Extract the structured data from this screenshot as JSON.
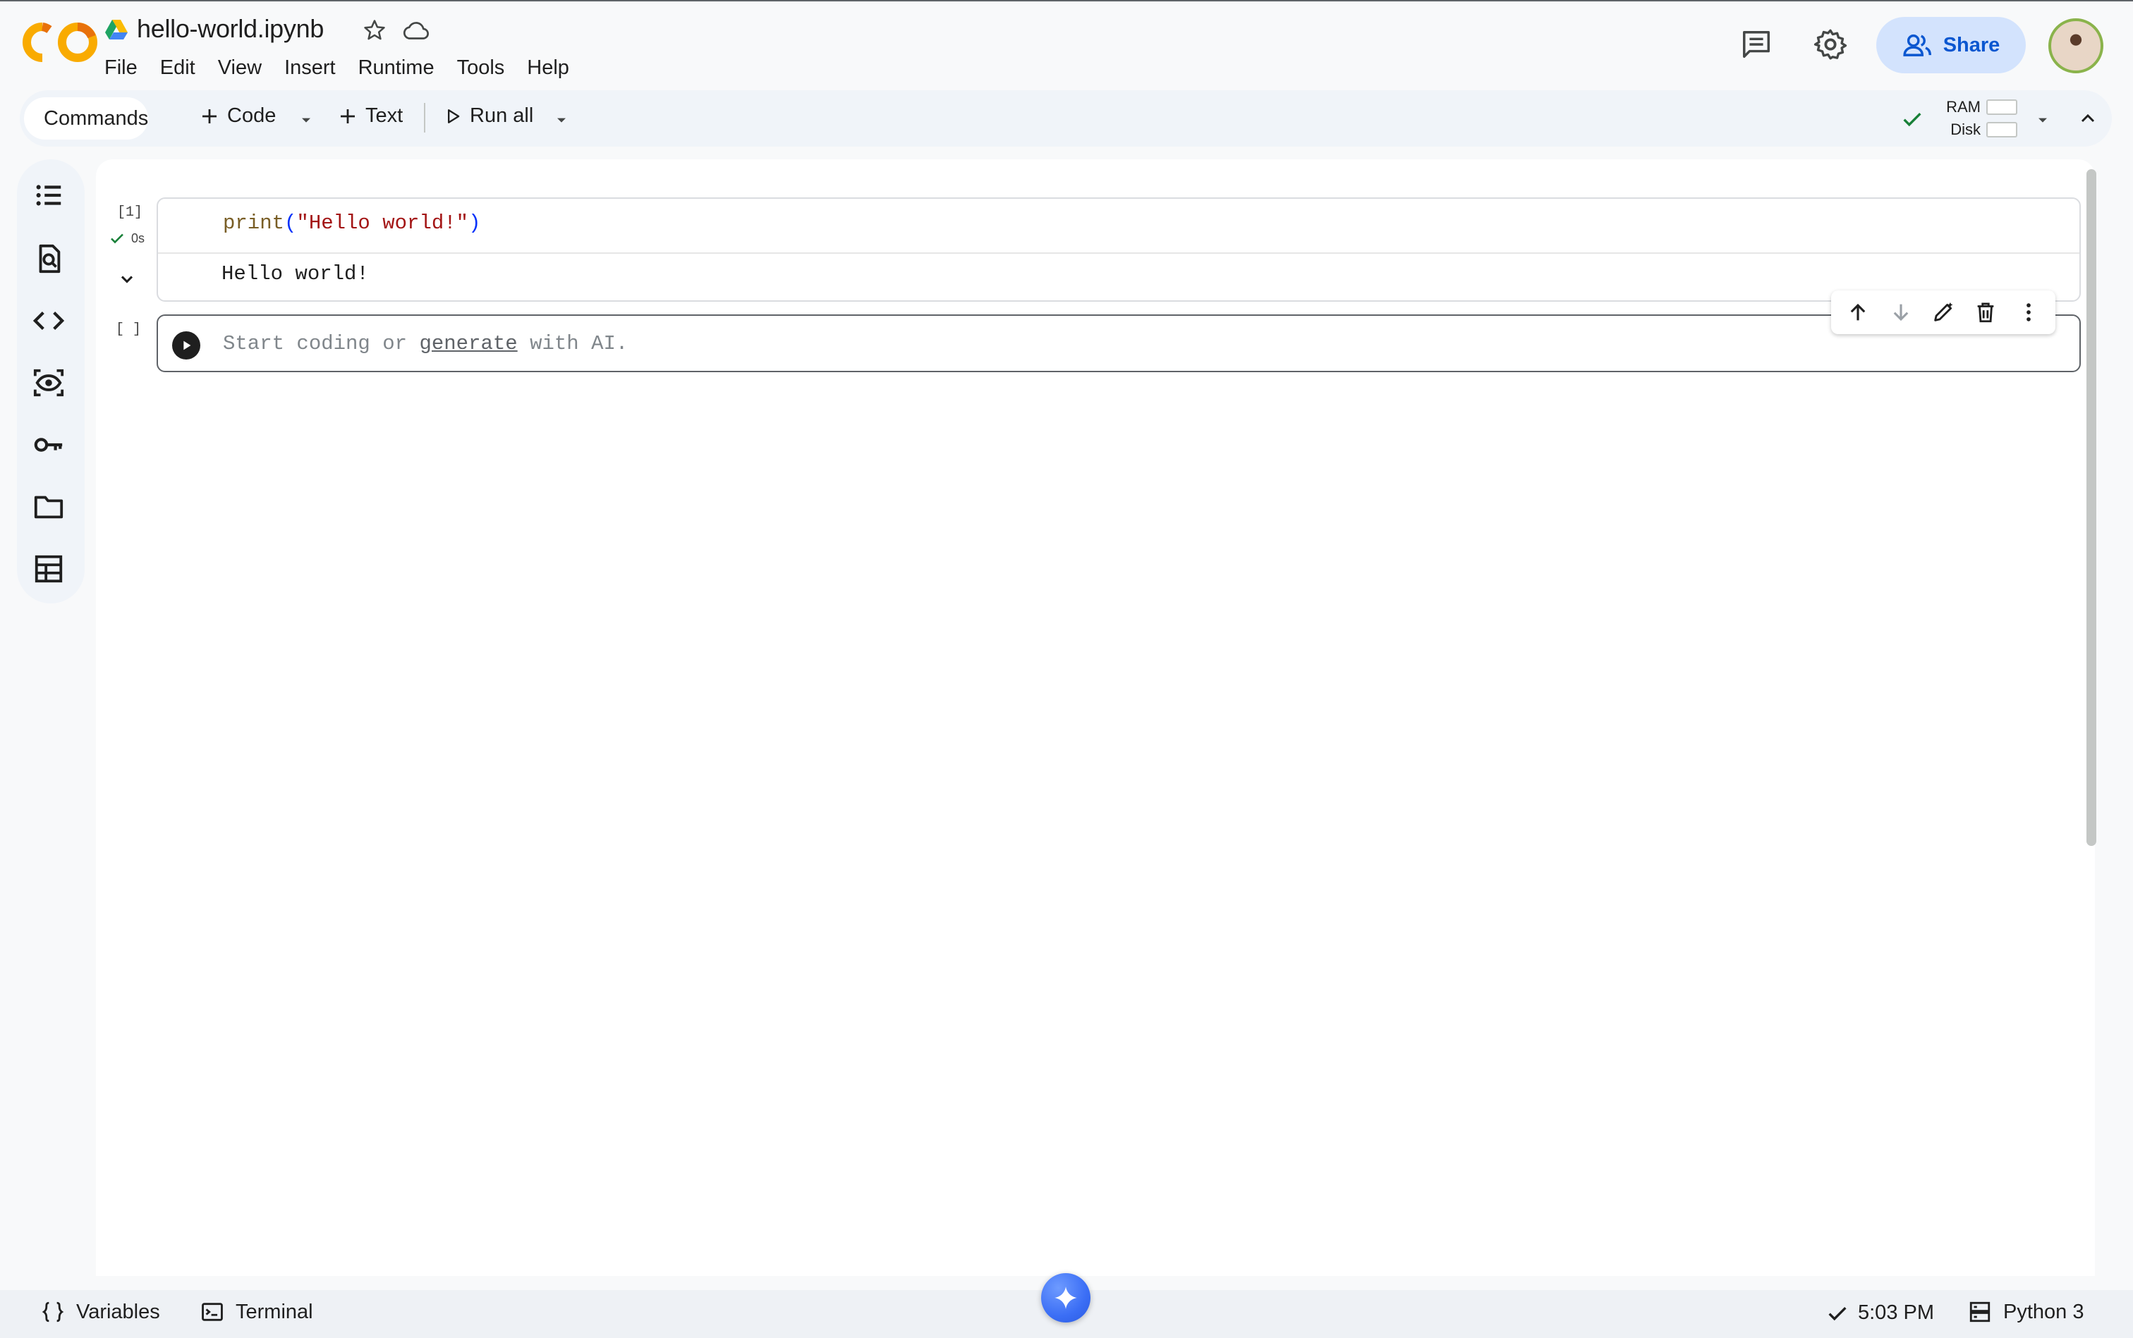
{
  "app": {
    "notebook_title": "hello-world.ipynb"
  },
  "menu": [
    "File",
    "Edit",
    "View",
    "Insert",
    "Runtime",
    "Tools",
    "Help"
  ],
  "header": {
    "share_label": "Share"
  },
  "toolbar": {
    "commands_label": "Commands",
    "code_label": "Code",
    "text_label": "Text",
    "run_all_label": "Run all",
    "ram_label": "RAM",
    "disk_label": "Disk"
  },
  "cells": [
    {
      "type": "code",
      "execution_count": "[1]",
      "exec_time": "0s",
      "code": {
        "fn": "print",
        "open": "(",
        "string": "\"Hello world!\"",
        "close": ")"
      },
      "output": "Hello world!"
    },
    {
      "type": "code",
      "execution_count": "[ ]",
      "placeholder_prefix": "Start coding or ",
      "placeholder_link": "generate",
      "placeholder_suffix": " with AI."
    }
  ],
  "statusbar": {
    "variables_label": "Variables",
    "terminal_label": "Terminal",
    "time": "5:03 PM",
    "kernel": "Python 3"
  },
  "colors": {
    "accent": "#0b57d0",
    "share_bg": "#d3e3fd",
    "logo_orange": "#f9ab00",
    "logo_dark_orange": "#e8710a",
    "success_green": "#188038",
    "gemini_blue": "#3b6ef5"
  },
  "icons": {
    "sidebar": [
      "table-of-contents-icon",
      "find-replace-icon",
      "code-snippets-icon",
      "variable-inspector-icon",
      "secrets-key-icon",
      "files-folder-icon",
      "data-table-icon"
    ],
    "cell_toolbar": [
      "move-up-icon",
      "move-down-icon",
      "edit-icon",
      "delete-icon",
      "more-vert-icon"
    ]
  }
}
